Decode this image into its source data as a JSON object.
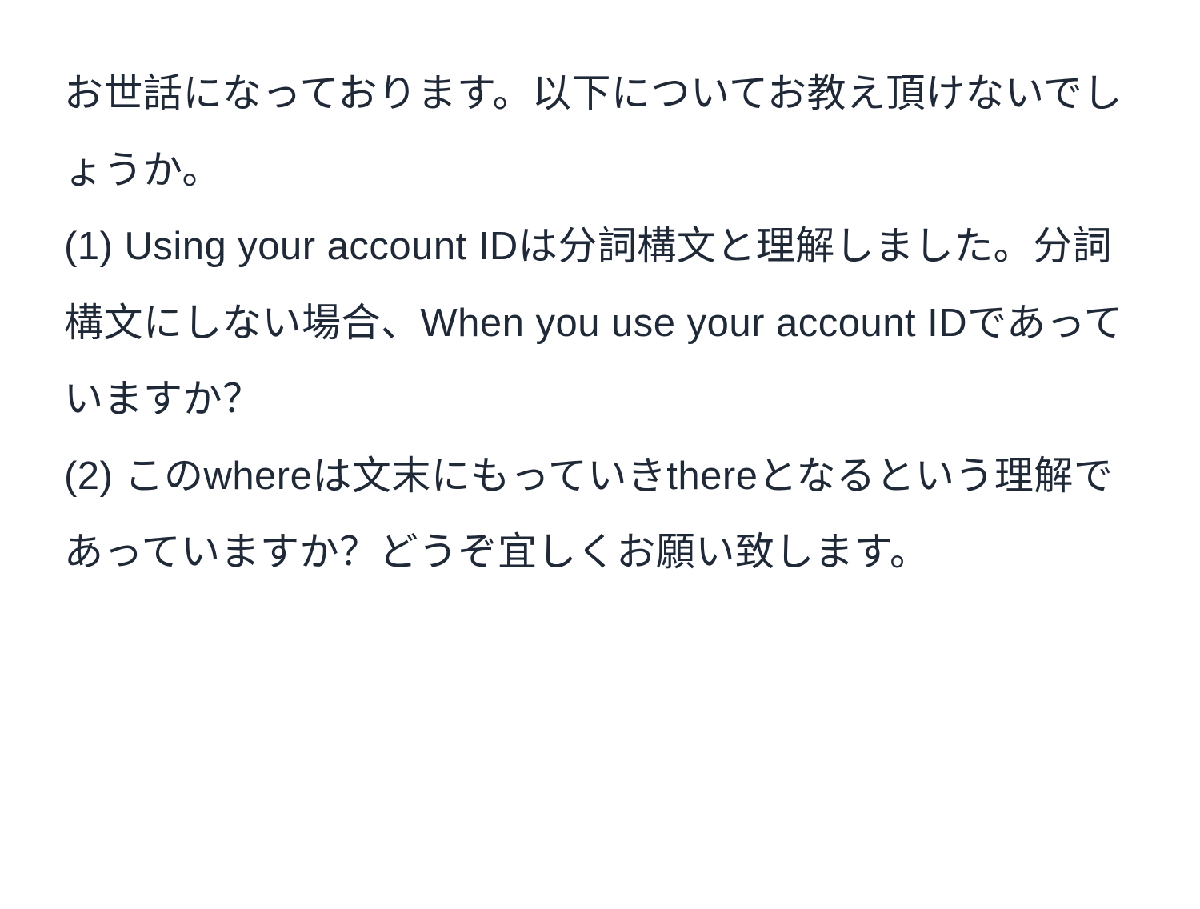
{
  "text": {
    "greeting": "お世話になっております。以下についてお教え頂けないでしょうか。",
    "q1": "(1) Using your account IDは分詞構文と理解しました。分詞構文にしない場合、When you use your account IDであっていますか？",
    "q2": "(2) このwhereは文末にもっていきthereとなるという理解であっていますか？どうぞ宜しくお願い致します。"
  }
}
